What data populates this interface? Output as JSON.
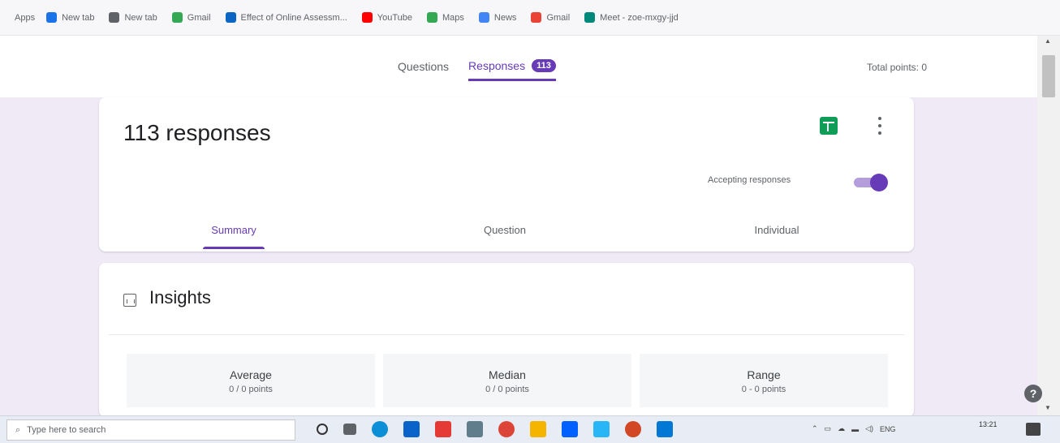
{
  "bookmarks": {
    "apps_label": "Apps",
    "items": [
      {
        "label": "New tab",
        "color": "#1a73e8"
      },
      {
        "label": "New tab",
        "color": "#5f6368"
      },
      {
        "label": "Gmail",
        "color": "#34a853"
      },
      {
        "label": "Effect of Online Assessm...",
        "color": "#0a66c2"
      },
      {
        "label": "YouTube",
        "color": "#ff0000"
      },
      {
        "label": "Maps",
        "color": "#34a853"
      },
      {
        "label": "News",
        "color": "#4285f4"
      },
      {
        "label": "Gmail",
        "color": "#ea4335"
      },
      {
        "label": "Meet - zoe-mxgy-jjd",
        "color": "#00897b"
      }
    ]
  },
  "header": {
    "tabs": [
      {
        "label": "Questions",
        "active": false
      },
      {
        "label": "Responses",
        "active": true,
        "badge": "113"
      }
    ],
    "total_points": "Total points: 0"
  },
  "responses_card": {
    "title": "113 responses",
    "sheets_icon": "sheets-icon",
    "more_icon": "more-vert-icon",
    "accepting_label": "Accepting responses",
    "accepting_on": true,
    "tabs": [
      {
        "label": "Summary",
        "active": true
      },
      {
        "label": "Question",
        "active": false
      },
      {
        "label": "Individual",
        "active": false
      }
    ]
  },
  "insights": {
    "title": "Insights",
    "icon": "insights-icon",
    "stats": [
      {
        "label": "Average",
        "value": "0 / 0 points"
      },
      {
        "label": "Median",
        "value": "0 / 0 points"
      },
      {
        "label": "Range",
        "value": "0 - 0 points"
      }
    ]
  },
  "taskbar": {
    "search_placeholder": "Type here to search",
    "apps": [
      {
        "name": "task-view-icon",
        "color": "#5f6368"
      },
      {
        "name": "edge-icon",
        "color": "#0c8fd6"
      },
      {
        "name": "mail-icon",
        "color": "#0a63c9"
      },
      {
        "name": "app-s-icon",
        "color": "#e53935"
      },
      {
        "name": "scanner-icon",
        "color": "#607d8b"
      },
      {
        "name": "chrome-icon",
        "color": "#db4437"
      },
      {
        "name": "explorer-icon",
        "color": "#f4b400"
      },
      {
        "name": "dropbox-icon",
        "color": "#0061fe"
      },
      {
        "name": "app-blue-icon",
        "color": "#29b6f6"
      },
      {
        "name": "powerpoint-icon",
        "color": "#d24726"
      },
      {
        "name": "outlook-icon",
        "color": "#0078d4"
      }
    ],
    "tray_text": "ENG",
    "time": "13:21"
  },
  "colors": {
    "accent": "#673ab7",
    "background": "#efeaf6"
  }
}
